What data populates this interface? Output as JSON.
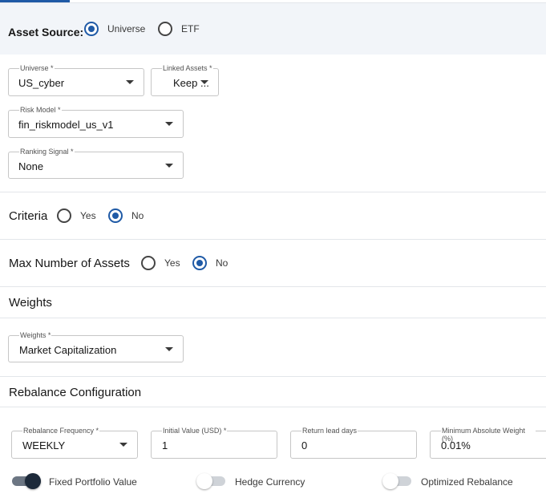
{
  "asset_source": {
    "label": "Asset Source:",
    "options": [
      {
        "label": "Universe",
        "selected": true
      },
      {
        "label": "ETF",
        "selected": false
      }
    ]
  },
  "universe": {
    "label": "Universe *",
    "value": "US_cyber"
  },
  "linked_assets": {
    "label": "Linked Assets *",
    "value": "Keep ..."
  },
  "risk_model": {
    "label": "Risk Model *",
    "value": "fin_riskmodel_us_v1"
  },
  "ranking_signal": {
    "label": "Ranking Signal *",
    "value": "None"
  },
  "criteria": {
    "title": "Criteria",
    "yes_label": "Yes",
    "no_label": "No",
    "selected": "No"
  },
  "max_assets": {
    "title": "Max Number of Assets",
    "yes_label": "Yes",
    "no_label": "No",
    "selected": "No"
  },
  "weights_section": {
    "title": "Weights",
    "field_label": "Weights *",
    "field_value": "Market Capitalization"
  },
  "rebalance": {
    "title": "Rebalance Configuration",
    "frequency": {
      "label": "Rebalance Frequency *",
      "value": "WEEKLY"
    },
    "initial_value": {
      "label": "Initial Value (USD) *",
      "value": "1"
    },
    "return_lead_days": {
      "label": "Return lead days",
      "value": "0"
    },
    "min_abs_weight": {
      "label": "Minimum Absolute Weight (%)",
      "value": "0.01%"
    }
  },
  "toggles": [
    {
      "label": "Fixed Portfolio Value",
      "on": true
    },
    {
      "label": "Hedge Currency",
      "on": false
    },
    {
      "label": "Optimized Rebalance",
      "on": false
    }
  ],
  "colors": {
    "accent": "#1f5aa6",
    "panel_bg": "#f2f5f9",
    "border": "#c6c6c6"
  }
}
